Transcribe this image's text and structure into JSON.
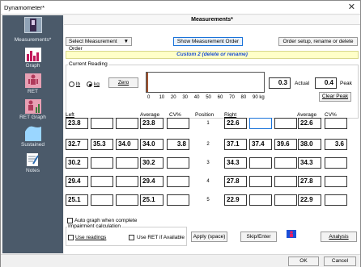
{
  "window": {
    "title": "Dynamometer*",
    "close": "✕"
  },
  "sidebar": {
    "items": [
      {
        "label": "Measurements*",
        "icon": "dynamometer-icon"
      },
      {
        "label": "Graph",
        "icon": "bar-graph-icon"
      },
      {
        "label": "RET",
        "icon": "body-icon"
      },
      {
        "label": "RET Graph",
        "icon": "body-graph-icon"
      },
      {
        "label": "Sustained",
        "icon": "curve-icon"
      },
      {
        "label": "Notes",
        "icon": "notes-icon"
      }
    ]
  },
  "panel": {
    "title": "Measurements*"
  },
  "toolbar": {
    "select_order": "Select Measurement Order",
    "show_order": "Show Measurement Order",
    "order_setup": "Order setup, rename or delete"
  },
  "banner": "Custom 2 (delete or rename)",
  "reading": {
    "group_label": "Current Reading",
    "unit_lb": "lb",
    "unit_kg": "kg",
    "selected_unit": "kg",
    "zero": "Zero",
    "actual_value": "0.3",
    "actual_label": "Actual",
    "peak_value": "0.4",
    "peak_label": "Peak",
    "clear_peak": "Clear Peak",
    "scale_ticks": [
      "0",
      "10",
      "20",
      "30",
      "40",
      "50",
      "60",
      "70",
      "80",
      "90 kg"
    ],
    "bar_value": 0.3,
    "bar_max": 90,
    "bar_color": "#a0522d"
  },
  "left": {
    "label": "Left",
    "avg_header": "Average",
    "cv_header": "CV%",
    "rows": [
      {
        "t1": "23.8",
        "t2": "",
        "t3": "",
        "avg": "23.8",
        "cv": ""
      },
      {
        "t1": "32.7",
        "t2": "35.3",
        "t3": "34.0",
        "avg": "34.0",
        "cv": "3.8"
      },
      {
        "t1": "30.2",
        "t2": "",
        "t3": "",
        "avg": "30.2",
        "cv": ""
      },
      {
        "t1": "29.4",
        "t2": "",
        "t3": "",
        "avg": "29.4",
        "cv": ""
      },
      {
        "t1": "25.1",
        "t2": "",
        "t3": "",
        "avg": "25.1",
        "cv": ""
      }
    ]
  },
  "position": {
    "header": "Position",
    "values": [
      "1",
      "2",
      "3",
      "4",
      "5"
    ]
  },
  "right": {
    "label": "Right",
    "avg_header": "Average",
    "cv_header": "CV%",
    "rows": [
      {
        "t1": "22.6",
        "t2": "",
        "t3": "",
        "avg": "22.6",
        "cv": ""
      },
      {
        "t1": "37.1",
        "t2": "37.4",
        "t3": "39.6",
        "avg": "38.0",
        "cv": "3.6"
      },
      {
        "t1": "34.3",
        "t2": "",
        "t3": "",
        "avg": "34.3",
        "cv": ""
      },
      {
        "t1": "27.8",
        "t2": "",
        "t3": "",
        "avg": "27.8",
        "cv": ""
      },
      {
        "t1": "22.9",
        "t2": "",
        "t3": "",
        "avg": "22.9",
        "cv": ""
      }
    ]
  },
  "options": {
    "auto_graph": "Auto graph when complete",
    "impairment_label": "Impairment calculation",
    "use_readings": "Use readings",
    "use_ret": "Use RET if Available"
  },
  "actions": {
    "apply": "Apply (space)",
    "skip": "Skip/Enter",
    "analysis": "Analysis"
  },
  "footer": {
    "ok": "OK",
    "cancel": "Cancel"
  }
}
